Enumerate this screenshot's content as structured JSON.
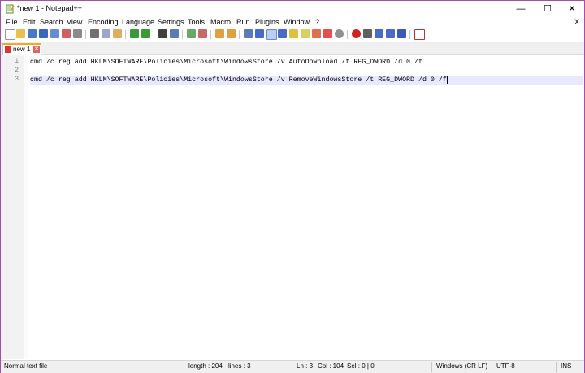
{
  "window": {
    "title": "*new 1 - Notepad++",
    "minimize_glyph": "—",
    "maximize_glyph": "☐",
    "close_glyph": "✕"
  },
  "menu": {
    "items": [
      "File",
      "Edit",
      "Search",
      "View",
      "Encoding",
      "Language",
      "Settings",
      "Tools",
      "Macro",
      "Run",
      "Plugins",
      "Window",
      "?"
    ],
    "close_doc": "X"
  },
  "toolbar": {
    "icons": [
      "new-file-icon",
      "open-file-icon",
      "save-icon",
      "save-all-icon",
      "close-icon",
      "close-all-icon",
      "print-icon",
      "cut-icon",
      "copy-icon",
      "paste-icon",
      "undo-icon",
      "redo-icon",
      "find-icon",
      "replace-icon",
      "zoom-in-icon",
      "zoom-out-icon",
      "sync-vertical-icon",
      "sync-horizontal-icon",
      "word-wrap-icon",
      "show-all-chars-icon",
      "indent-guide-icon",
      "user-defined-language-icon",
      "document-map-icon",
      "function-list-icon",
      "folder-as-workspace-icon",
      "monitoring-icon",
      "record-macro-icon",
      "stop-record-icon",
      "play-macro-icon",
      "play-multiple-icon",
      "save-macro-icon",
      "spell-check-icon"
    ]
  },
  "tabs": [
    {
      "label": "new 1",
      "active": true
    }
  ],
  "editor": {
    "lines": [
      {
        "number": "1",
        "text": "cmd /c reg add HKLM\\SOFTWARE\\Policies\\Microsoft\\WindowsStore /v AutoDownload /t REG_DWORD /d 0 /f",
        "current": false
      },
      {
        "number": "2",
        "text": "",
        "current": false
      },
      {
        "number": "3",
        "text": "cmd /c reg add HKLM\\SOFTWARE\\Policies\\Microsoft\\WindowsStore /v RemoveWindowsStore /t REG_DWORD /d 0 /f",
        "current": true
      }
    ]
  },
  "status": {
    "file_type": "Normal text file",
    "length": "length : 204",
    "lines": "lines : 3",
    "ln": "Ln : 3",
    "col": "Col : 104",
    "sel": "Sel : 0 | 0",
    "eol": "Windows (CR LF)",
    "encoding": "UTF-8",
    "mode": "INS"
  }
}
